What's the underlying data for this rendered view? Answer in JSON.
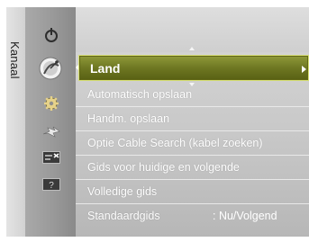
{
  "sidebar": {
    "tab_label": "Kanaal"
  },
  "icons": [
    {
      "name": "power-icon",
      "active": false
    },
    {
      "name": "satellite-dish-icon",
      "active": true
    },
    {
      "name": "gear-icon",
      "active": false
    },
    {
      "name": "signal-icon",
      "active": false
    },
    {
      "name": "tv-program-icon",
      "active": false
    },
    {
      "name": "help-icon",
      "active": false
    }
  ],
  "menu": {
    "selected": {
      "label": "Land"
    },
    "items": [
      {
        "label": "Automatisch opslaan"
      },
      {
        "label": "Handm. opslaan"
      },
      {
        "label": "Optie Cable Search (kabel zoeken)"
      },
      {
        "label": "Gids voor huidige en volgende"
      },
      {
        "label": "Volledige gids"
      },
      {
        "label": "Standaardgids",
        "value": ": Nu/Volgend"
      }
    ]
  },
  "help_badge": "?",
  "colors": {
    "highlight": "#6e7722",
    "highlight_border": "#d7df76",
    "text": "#ffffff"
  }
}
